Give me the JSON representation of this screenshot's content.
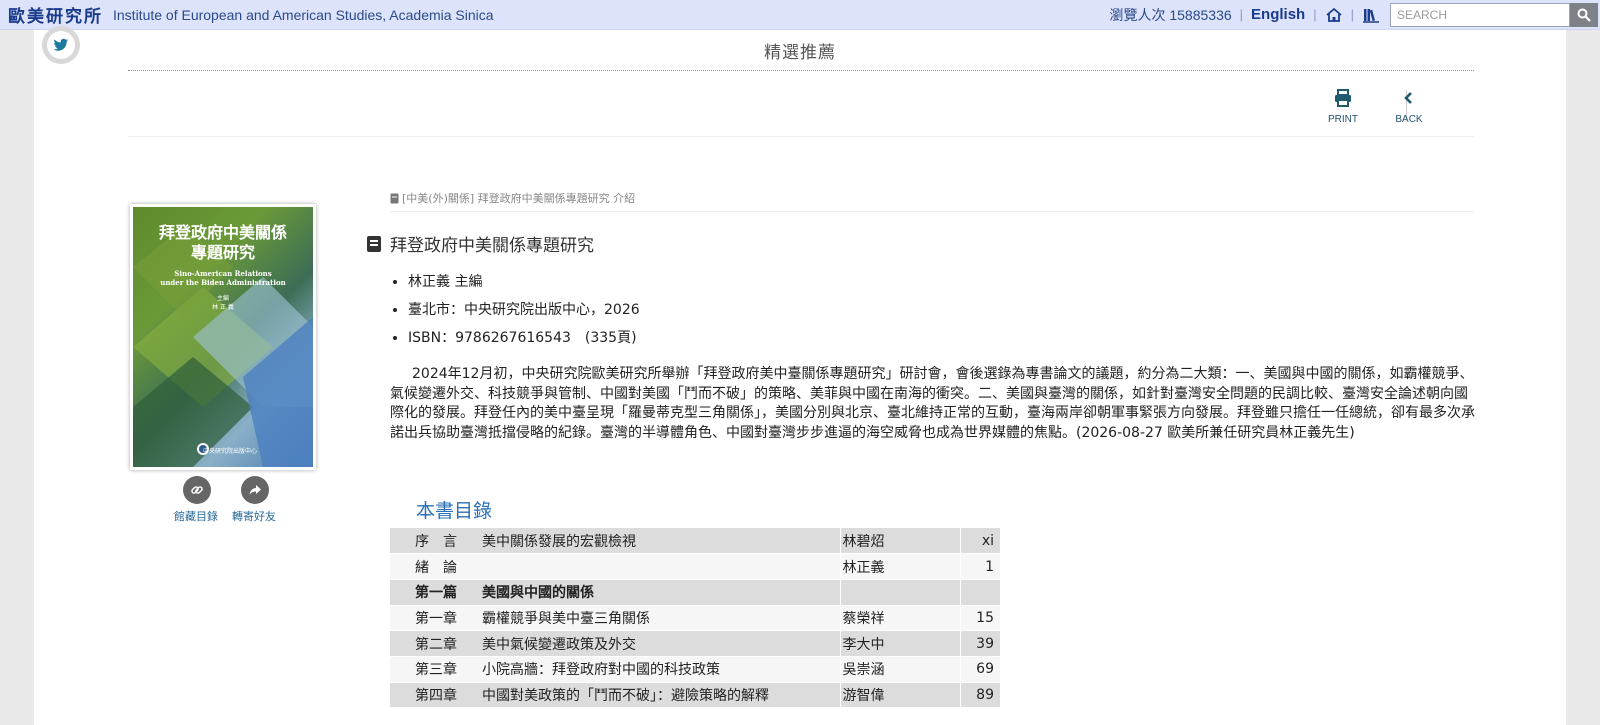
{
  "topbar": {
    "logo_text": "歐美研究所",
    "institute_name": "Institute of European and American Studies, Academia Sinica",
    "visits_label": "瀏覽人次 15885336",
    "lang_link": "English",
    "search_placeholder": "SEARCH",
    "icons": [
      "home-icon",
      "books-icon",
      "search-icon"
    ]
  },
  "section": {
    "title": "精選推薦",
    "print_label": "PRINT",
    "back_label": "BACK"
  },
  "cover": {
    "title_line1": "拜登政府中美關係",
    "title_line2": "專題研究",
    "subtitle_line1": "Sino-American Relations",
    "subtitle_line2": "under the Biden Administration",
    "editor_label": "主編",
    "editor_name": "林 正 義",
    "publisher": "中央研究院出版中心"
  },
  "actions": {
    "collect_label": "館藏目錄",
    "share_label": "轉寄好友"
  },
  "breadcrumb": "[中美(外)關係] 拜登政府中美關係專題研究 介紹",
  "book": {
    "title": "拜登政府中美關係專題研究",
    "editor": "林正義 主編",
    "publisher": "臺北市：中央研究院出版中心，2026",
    "isbn": "ISBN：9786267616543　(335頁)",
    "abstract": "2024年12月初，中央研究院歐美研究所舉辦「拜登政府美中臺關係專題研究」研討會，會後選錄為專書論文的議題，約分為二大類：一、美國與中國的關係，如霸權競爭、氣候變遷外交、科技競爭與管制、中國對美國「鬥而不破」的策略、美菲與中國在南海的衝突。二、美國與臺灣的關係，如針對臺灣安全問題的民調比較、臺灣安全論述朝向國際化的發展。拜登任內的美中臺呈現「羅曼蒂克型三角關係」，美國分別與北京、臺北維持正常的互動，臺海兩岸卻朝軍事緊張方向發展。拜登雖只擔任一任總統，卻有最多次承諾出兵協助臺灣抵擋侵略的紀錄。臺灣的半導體角色、中國對臺灣步步進逼的海空威脅也成為世界媒體的焦點。(2026-08-27 歐美所兼任研究員林正義先生)"
  },
  "toc": {
    "title": "本書目錄",
    "rows": [
      {
        "num": "序　言",
        "title": "美中關係發展的宏觀檢視",
        "author": "林碧炤",
        "page": "xi"
      },
      {
        "num": "緒　論",
        "title": "",
        "author": "林正義",
        "page": "1"
      },
      {
        "num": "第一篇",
        "title": "美國與中國的關係",
        "author": "",
        "page": ""
      },
      {
        "num": "第一章",
        "title": "霸權競爭與美中臺三角關係",
        "author": "蔡榮祥",
        "page": "15"
      },
      {
        "num": "第二章",
        "title": "美中氣候變遷政策及外交",
        "author": "李大中",
        "page": "39"
      },
      {
        "num": "第三章",
        "title": "小院高牆：拜登政府對中國的科技政策",
        "author": "吳崇涵",
        "page": "69"
      },
      {
        "num": "第四章",
        "title": "中國對美政策的「鬥而不破」：避險策略的解釋",
        "author": "游智偉",
        "page": "89"
      }
    ]
  }
}
